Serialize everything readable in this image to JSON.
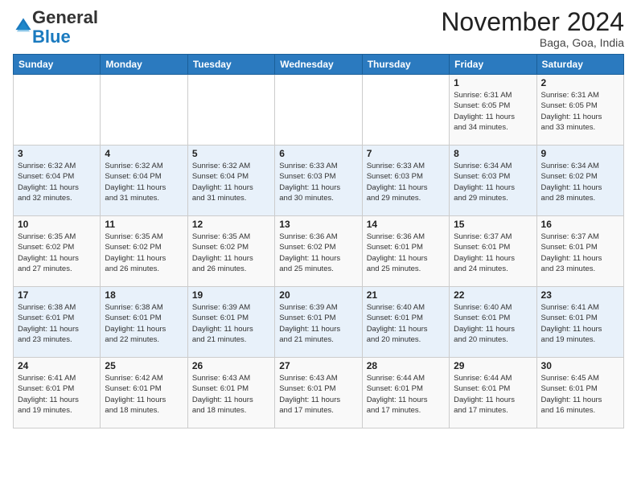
{
  "header": {
    "logo_general": "General",
    "logo_blue": "Blue",
    "month_title": "November 2024",
    "location": "Baga, Goa, India"
  },
  "weekdays": [
    "Sunday",
    "Monday",
    "Tuesday",
    "Wednesday",
    "Thursday",
    "Friday",
    "Saturday"
  ],
  "weeks": [
    [
      {
        "day": "",
        "info": ""
      },
      {
        "day": "",
        "info": ""
      },
      {
        "day": "",
        "info": ""
      },
      {
        "day": "",
        "info": ""
      },
      {
        "day": "",
        "info": ""
      },
      {
        "day": "1",
        "info": "Sunrise: 6:31 AM\nSunset: 6:05 PM\nDaylight: 11 hours\nand 34 minutes."
      },
      {
        "day": "2",
        "info": "Sunrise: 6:31 AM\nSunset: 6:05 PM\nDaylight: 11 hours\nand 33 minutes."
      }
    ],
    [
      {
        "day": "3",
        "info": "Sunrise: 6:32 AM\nSunset: 6:04 PM\nDaylight: 11 hours\nand 32 minutes."
      },
      {
        "day": "4",
        "info": "Sunrise: 6:32 AM\nSunset: 6:04 PM\nDaylight: 11 hours\nand 31 minutes."
      },
      {
        "day": "5",
        "info": "Sunrise: 6:32 AM\nSunset: 6:04 PM\nDaylight: 11 hours\nand 31 minutes."
      },
      {
        "day": "6",
        "info": "Sunrise: 6:33 AM\nSunset: 6:03 PM\nDaylight: 11 hours\nand 30 minutes."
      },
      {
        "day": "7",
        "info": "Sunrise: 6:33 AM\nSunset: 6:03 PM\nDaylight: 11 hours\nand 29 minutes."
      },
      {
        "day": "8",
        "info": "Sunrise: 6:34 AM\nSunset: 6:03 PM\nDaylight: 11 hours\nand 29 minutes."
      },
      {
        "day": "9",
        "info": "Sunrise: 6:34 AM\nSunset: 6:02 PM\nDaylight: 11 hours\nand 28 minutes."
      }
    ],
    [
      {
        "day": "10",
        "info": "Sunrise: 6:35 AM\nSunset: 6:02 PM\nDaylight: 11 hours\nand 27 minutes."
      },
      {
        "day": "11",
        "info": "Sunrise: 6:35 AM\nSunset: 6:02 PM\nDaylight: 11 hours\nand 26 minutes."
      },
      {
        "day": "12",
        "info": "Sunrise: 6:35 AM\nSunset: 6:02 PM\nDaylight: 11 hours\nand 26 minutes."
      },
      {
        "day": "13",
        "info": "Sunrise: 6:36 AM\nSunset: 6:02 PM\nDaylight: 11 hours\nand 25 minutes."
      },
      {
        "day": "14",
        "info": "Sunrise: 6:36 AM\nSunset: 6:01 PM\nDaylight: 11 hours\nand 25 minutes."
      },
      {
        "day": "15",
        "info": "Sunrise: 6:37 AM\nSunset: 6:01 PM\nDaylight: 11 hours\nand 24 minutes."
      },
      {
        "day": "16",
        "info": "Sunrise: 6:37 AM\nSunset: 6:01 PM\nDaylight: 11 hours\nand 23 minutes."
      }
    ],
    [
      {
        "day": "17",
        "info": "Sunrise: 6:38 AM\nSunset: 6:01 PM\nDaylight: 11 hours\nand 23 minutes."
      },
      {
        "day": "18",
        "info": "Sunrise: 6:38 AM\nSunset: 6:01 PM\nDaylight: 11 hours\nand 22 minutes."
      },
      {
        "day": "19",
        "info": "Sunrise: 6:39 AM\nSunset: 6:01 PM\nDaylight: 11 hours\nand 21 minutes."
      },
      {
        "day": "20",
        "info": "Sunrise: 6:39 AM\nSunset: 6:01 PM\nDaylight: 11 hours\nand 21 minutes."
      },
      {
        "day": "21",
        "info": "Sunrise: 6:40 AM\nSunset: 6:01 PM\nDaylight: 11 hours\nand 20 minutes."
      },
      {
        "day": "22",
        "info": "Sunrise: 6:40 AM\nSunset: 6:01 PM\nDaylight: 11 hours\nand 20 minutes."
      },
      {
        "day": "23",
        "info": "Sunrise: 6:41 AM\nSunset: 6:01 PM\nDaylight: 11 hours\nand 19 minutes."
      }
    ],
    [
      {
        "day": "24",
        "info": "Sunrise: 6:41 AM\nSunset: 6:01 PM\nDaylight: 11 hours\nand 19 minutes."
      },
      {
        "day": "25",
        "info": "Sunrise: 6:42 AM\nSunset: 6:01 PM\nDaylight: 11 hours\nand 18 minutes."
      },
      {
        "day": "26",
        "info": "Sunrise: 6:43 AM\nSunset: 6:01 PM\nDaylight: 11 hours\nand 18 minutes."
      },
      {
        "day": "27",
        "info": "Sunrise: 6:43 AM\nSunset: 6:01 PM\nDaylight: 11 hours\nand 17 minutes."
      },
      {
        "day": "28",
        "info": "Sunrise: 6:44 AM\nSunset: 6:01 PM\nDaylight: 11 hours\nand 17 minutes."
      },
      {
        "day": "29",
        "info": "Sunrise: 6:44 AM\nSunset: 6:01 PM\nDaylight: 11 hours\nand 17 minutes."
      },
      {
        "day": "30",
        "info": "Sunrise: 6:45 AM\nSunset: 6:01 PM\nDaylight: 11 hours\nand 16 minutes."
      }
    ]
  ]
}
